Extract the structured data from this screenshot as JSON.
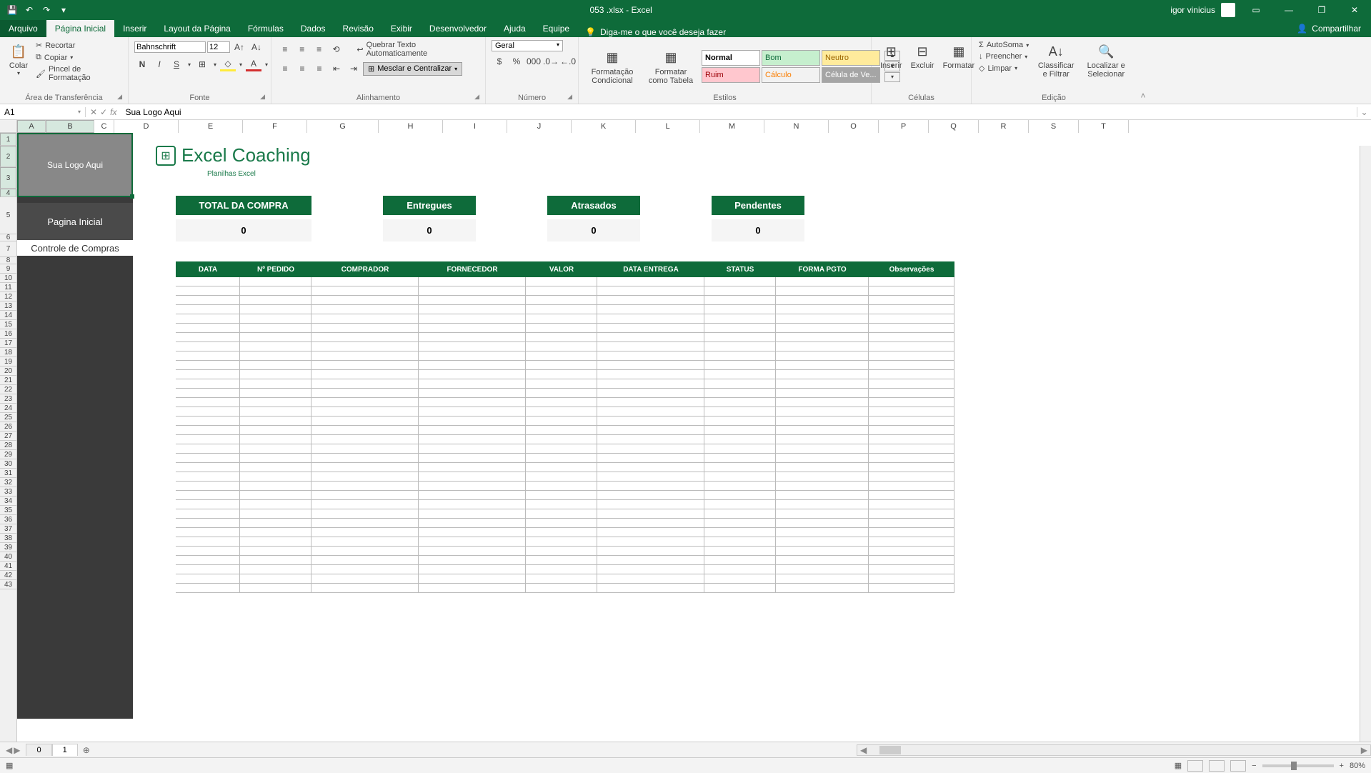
{
  "app": {
    "title": "053 .xlsx - Excel",
    "user": "igor vinicius"
  },
  "menu": {
    "file": "Arquivo",
    "tabs": [
      "Página Inicial",
      "Inserir",
      "Layout da Página",
      "Fórmulas",
      "Dados",
      "Revisão",
      "Exibir",
      "Desenvolvedor",
      "Ajuda",
      "Equipe"
    ],
    "tellme": "Diga-me o que você deseja fazer",
    "share": "Compartilhar"
  },
  "ribbon": {
    "clipboard": {
      "paste": "Colar",
      "cut": "Recortar",
      "copy": "Copiar",
      "format_painter": "Pincel de Formatação",
      "label": "Área de Transferência"
    },
    "font": {
      "name": "Bahnschrift",
      "size": "12",
      "label": "Fonte"
    },
    "align": {
      "wrap": "Quebrar Texto Automaticamente",
      "merge": "Mesclar e Centralizar",
      "label": "Alinhamento"
    },
    "number": {
      "format": "Geral",
      "label": "Número"
    },
    "styles": {
      "cond": "Formatação Condicional",
      "table": "Formatar como Tabela",
      "cells": [
        "Normal",
        "Bom",
        "Neutro",
        "Ruim",
        "Cálculo",
        "Célula de Ve..."
      ],
      "label": "Estilos"
    },
    "cells": {
      "insert": "Inserir",
      "delete": "Excluir",
      "format": "Formatar",
      "label": "Células"
    },
    "editing": {
      "autosum": "AutoSoma",
      "fill": "Preencher",
      "clear": "Limpar",
      "sort": "Classificar e Filtrar",
      "find": "Localizar e Selecionar",
      "label": "Edição"
    }
  },
  "namebox": {
    "ref": "A1",
    "formula": "Sua Logo Aqui"
  },
  "columns": [
    "A",
    "B",
    "C",
    "D",
    "E",
    "F",
    "G",
    "H",
    "I",
    "J",
    "K",
    "L",
    "M",
    "N",
    "O",
    "P",
    "Q",
    "R",
    "S",
    "T"
  ],
  "sheet": {
    "logo_placeholder": "Sua Logo Aqui",
    "nav": [
      "Pagina Inicial",
      "Controle de Compras"
    ],
    "brand": {
      "name": "Excel Coaching",
      "sub": "Planilhas Excel"
    },
    "kpis": [
      {
        "label": "TOTAL DA COMPRA",
        "value": "0"
      },
      {
        "label": "Entregues",
        "value": "0"
      },
      {
        "label": "Atrasados",
        "value": "0"
      },
      {
        "label": "Pendentes",
        "value": "0"
      }
    ],
    "table_headers": [
      "DATA",
      "Nº PEDIDO",
      "COMPRADOR",
      "FORNECEDOR",
      "VALOR",
      "DATA ENTREGA",
      "STATUS",
      "FORMA PGTO",
      "Observações"
    ]
  },
  "tabs": {
    "sheets": [
      "0",
      "1"
    ],
    "active": 1
  },
  "status": {
    "zoom": "80%"
  }
}
